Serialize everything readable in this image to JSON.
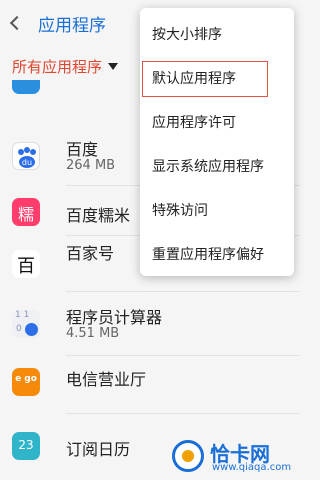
{
  "header": {
    "title": "应用程序"
  },
  "filter": {
    "label": "所有应用程序"
  },
  "apps": [
    {
      "name": "百度",
      "size": "264 MB",
      "icon": "baidu-icon"
    },
    {
      "name": "百度糯米",
      "size": "",
      "icon": "baidu-nuomi-icon"
    },
    {
      "name": "百家号",
      "size": "",
      "icon": "baijiahao-icon"
    },
    {
      "name": "程序员计算器",
      "size": "4.51 MB",
      "icon": "programmer-calculator-icon"
    },
    {
      "name": "电信营业厅",
      "size": "",
      "icon": "telecom-hall-icon"
    },
    {
      "name": "订阅日历",
      "size": "",
      "icon": "subscription-calendar-icon"
    }
  ],
  "icon_glyphs": {
    "nuomi": "糯",
    "baijiahao": "百",
    "calc_top": "1 1",
    "calc_bottom": "0",
    "calendar": "23",
    "baidu": "du",
    "telecom": "e go"
  },
  "menu": {
    "items": [
      {
        "label": "按大小排序"
      },
      {
        "label": "默认应用程序",
        "highlighted": true
      },
      {
        "label": "应用程序许可"
      },
      {
        "label": "显示系统应用程序"
      },
      {
        "label": "特殊访问"
      },
      {
        "label": "重置应用程序偏好"
      }
    ]
  },
  "watermark": {
    "text": "恰卡网",
    "url": "www.qiaqa.com"
  },
  "colors": {
    "accent": "#1a6fd6",
    "filter": "#e0462f",
    "highlight_border": "#e0544a"
  }
}
